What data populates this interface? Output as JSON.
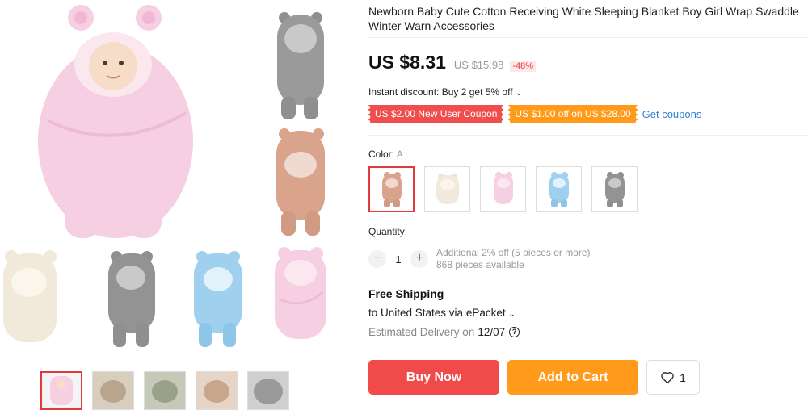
{
  "product": {
    "title": "Newborn Baby Cute Cotton Receiving White Sleeping Blanket Boy Girl Wrap Swaddle Winter Warn Accessories",
    "price": "US $8.31",
    "old_price": "US $15.98",
    "discount": "-48%"
  },
  "promo": {
    "instant_discount": "Instant discount: Buy 2 get 5% off",
    "coupons": [
      "US $2.00 New User Coupon",
      "US $1.00 off on US $28.00"
    ],
    "get_coupons": "Get coupons"
  },
  "color": {
    "label": "Color:",
    "selected": "A",
    "options": [
      {
        "name": "pink-tan",
        "color": "#d9a38c"
      },
      {
        "name": "white",
        "color": "#f1e9da"
      },
      {
        "name": "pink",
        "color": "#f6cfe2"
      },
      {
        "name": "blue",
        "color": "#9fd0ee"
      },
      {
        "name": "grey",
        "color": "#8f8f8f"
      }
    ]
  },
  "quantity": {
    "label": "Quantity:",
    "minus": "−",
    "plus": "+",
    "value": "1",
    "note_line1": "Additional 2% off (5 pieces or more)",
    "note_line2": "868 pieces available"
  },
  "shipping": {
    "title": "Free Shipping",
    "to": "to United States via ePacket",
    "estimated_label": "Estimated Delivery on",
    "date": "12/07"
  },
  "actions": {
    "buy": "Buy Now",
    "cart": "Add to Cart",
    "wish_count": "1"
  },
  "gallery": {
    "hero_colors": [
      "#f6cfe2",
      "#9a9a9a",
      "#d9a38c",
      "#f1e9da",
      "#8f8f8f",
      "#9fd0ee",
      "#f6cfe2"
    ],
    "thumb_colors": [
      "#f6cfe2",
      "#b9a48e",
      "#9aa08a",
      "#c9a58c",
      "#9a9a9a"
    ]
  }
}
